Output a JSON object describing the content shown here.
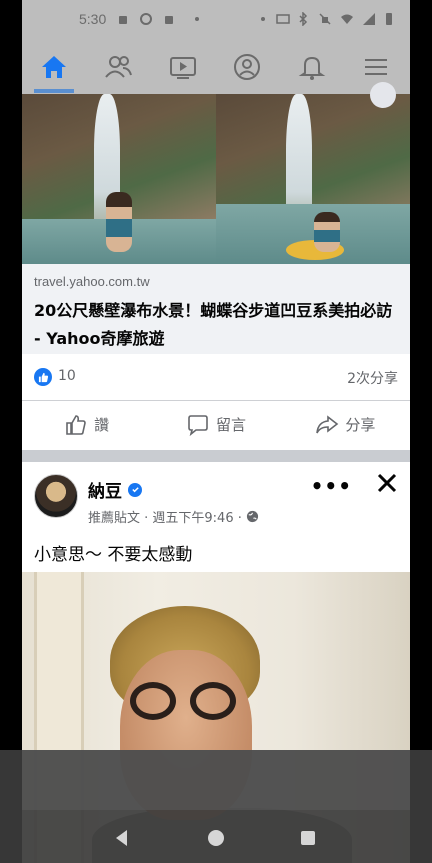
{
  "status_bar": {
    "time": "5:30"
  },
  "nav": {
    "tabs": [
      "home-icon",
      "friends-icon",
      "watch-icon",
      "profile-icon",
      "notifications-icon",
      "menu-icon"
    ],
    "active_color": "#1877f2"
  },
  "link_post": {
    "domain": "travel.yahoo.com.tw",
    "headline": "20公尺懸壁瀑布水景！蝴蝶谷步道凹豆系美拍必訪 - Yahoo奇摩旅遊",
    "like_count": "10",
    "shares": "2次分享",
    "actions": {
      "like": "讚",
      "comment": "留言",
      "share": "分享"
    }
  },
  "post": {
    "author": "納豆",
    "meta": "推薦貼文 · 週五下午9:46 ·",
    "text": "小意思～ 不要太感動"
  },
  "colors": {
    "brand": "#1877f2",
    "secondary_text": "#65676b"
  }
}
